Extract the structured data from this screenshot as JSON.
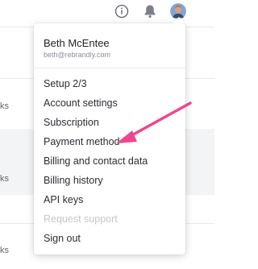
{
  "user": {
    "name": "Beth McEntee",
    "email": "beth@rebrandly.com"
  },
  "topbar": {
    "info_icon": "info-circle-icon",
    "bell_icon": "bell-icon",
    "avatar": "user-avatar"
  },
  "background": {
    "row1_suffix": "ks",
    "row2_suffix": "ks",
    "row3_suffix": "ks"
  },
  "menu": {
    "items": [
      {
        "label": "Setup 2/3",
        "enabled": true
      },
      {
        "label": "Account settings",
        "enabled": true
      },
      {
        "label": "Subscription",
        "enabled": true
      },
      {
        "label": "Payment method",
        "enabled": true
      },
      {
        "label": "Billing and contact data",
        "enabled": true
      },
      {
        "label": "Billing history",
        "enabled": true
      },
      {
        "label": "API keys",
        "enabled": true
      },
      {
        "label": "Request support",
        "enabled": false
      },
      {
        "label": "Sign out",
        "enabled": true
      }
    ]
  },
  "colors": {
    "arrow": "#f0468f",
    "disabled_text": "#c4c7cd"
  }
}
